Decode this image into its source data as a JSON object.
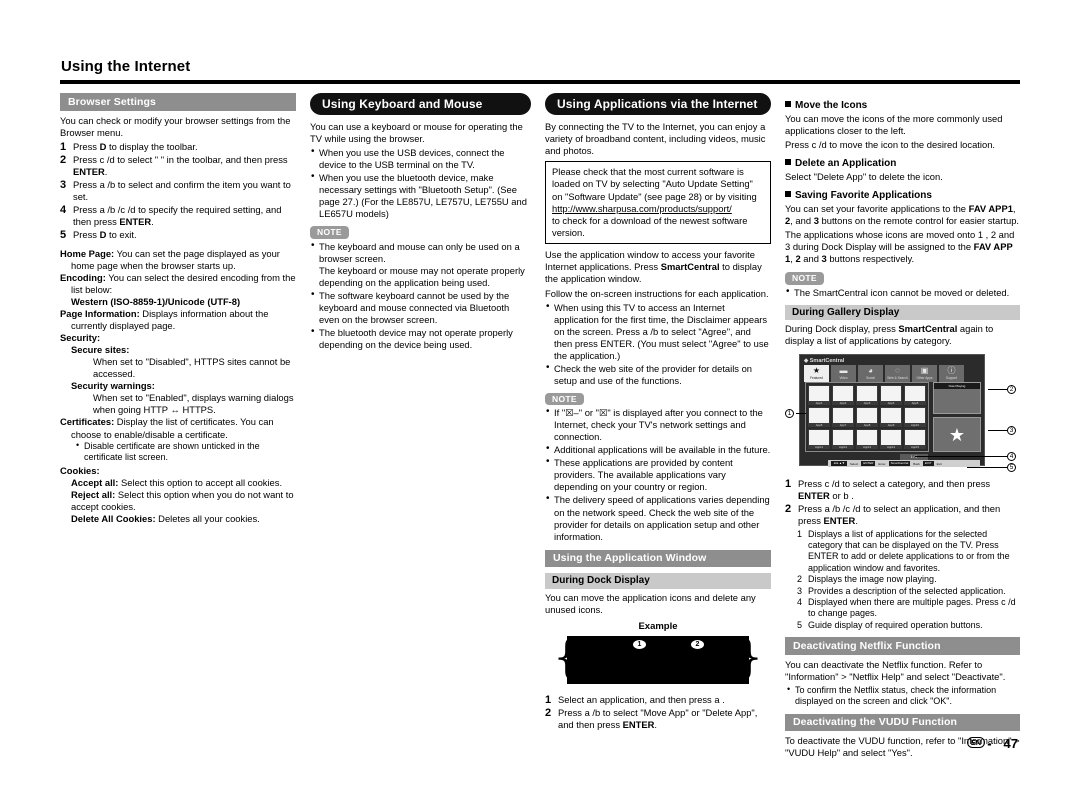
{
  "page": {
    "title": "Using the Internet",
    "footer_locale": "EN",
    "footer_sep": "-",
    "footer_page": "47"
  },
  "col1": {
    "heading": "Browser Settings",
    "intro": "You can check or modify your browser settings from the Browser menu.",
    "steps": [
      {
        "n": "1",
        "text_a": "Press ",
        "bold_a": "D",
        "text_b": " to display the toolbar."
      },
      {
        "n": "2",
        "text_a": "Press c /d  to select \"     \" in the toolbar, and then press ",
        "bold_a": "ENTER",
        "text_b": "."
      },
      {
        "n": "3",
        "text_a": "Press a /b  to select and confirm the item you want to set.",
        "bold_a": "",
        "text_b": ""
      },
      {
        "n": "4",
        "text_a": "Press a /b /c /d  to specify the required setting, and then press ",
        "bold_a": "ENTER",
        "text_b": "."
      },
      {
        "n": "5",
        "text_a": "Press ",
        "bold_a": "D",
        "text_b": " to exit."
      }
    ],
    "terms": [
      {
        "term": "Home Page:",
        "desc": " You can set the page displayed as your home page when the browser starts up."
      },
      {
        "term": "Encoding:",
        "desc": " You can select the desired encoding from the list below:"
      }
    ],
    "encoding_value": "Western (ISO-8859-1)/Unicode (UTF-8)",
    "page_information": {
      "term": "Page Information:",
      "desc": " Displays information about the currently displayed page."
    },
    "security_label": "Security:",
    "secure_sites": {
      "term": "Secure sites:",
      "desc": "When set to \"Disabled\", HTTPS sites cannot be accessed."
    },
    "security_warnings": {
      "term": "Security warnings:",
      "desc": "When set to \"Enabled\", displays warning dialogs when going HTTP ↔ HTTPS."
    },
    "certificates": {
      "term": "Certificates:",
      "desc": " Display the list of certificates. You can choose to enable/disable a certificate."
    },
    "certificates_note": "Disable certificate are shown unticked in the certificate list screen.",
    "cookies_label": "Cookies:",
    "cookies": [
      {
        "term": "Accept all:",
        "desc": " Select this option to accept all cookies."
      },
      {
        "term": "Reject all:",
        "desc": " Select this option when you do not want to accept cookies."
      },
      {
        "term": "Delete All Cookies:",
        "desc": " Deletes all your cookies."
      }
    ]
  },
  "col2": {
    "heading": "Using Keyboard and Mouse",
    "intro": "You can use a keyboard or mouse for operating the TV while using the browser.",
    "bullets": [
      "When you use the USB devices, connect the device to the USB terminal on the TV.",
      "When you use the bluetooth device, make necessary settings with \"Bluetooth Setup\". (See page 27.) (For the LE857U, LE757U, LE755U and LE657U models)"
    ],
    "note_label": "NOTE",
    "notes": [
      "The keyboard and mouse can only be used on a browser screen.\nThe keyboard or mouse may not operate properly depending on the application being used.",
      "The software keyboard cannot be used by the keyboard and mouse connected via Bluetooth even on the browser screen.",
      "The bluetooth device may not operate properly depending on the device being used."
    ]
  },
  "col3": {
    "heading": "Using Applications via the Internet",
    "intro": "By connecting the TV to the Internet, you can enjoy a variety of broadband content, including videos, music and photos.",
    "box": {
      "line1": "Please check that the most current software is loaded on TV by selecting \"Auto Update Setting\"",
      "line2": "on \"Software Update\" (see page 28) or by visiting",
      "url": "http://www.sharpusa.com/products/support/",
      "line3": "to check for a download of the newest software version."
    },
    "body_1": "Use the application window to access your favorite Internet applications. Press ",
    "body_bold": "SmartCentral",
    "body_2": " to display the application window.",
    "body_3": "Follow the on-screen instructions for each application.",
    "bullets": [
      "When using this TV to access an Internet application for the first time, the Disclaimer appears on the screen. Press a /b  to select \"Agree\", and then press ENTER. (You must select \"Agree\" to use the application.)",
      "Check the web site of the provider for details on setup and use of the functions."
    ],
    "note_label": "NOTE",
    "notes": [
      "If \"☒–\" or \"☒\" is displayed after you connect to the Internet, check your TV's network settings and connection.",
      "Additional applications will be available in the future.",
      "These applications are provided by content providers. The available applications vary depending on your country or region.",
      "The delivery speed of applications varies depending on the network speed. Check the web site of the provider for details on application setup and other information."
    ],
    "app_window_heading": "Using the Application Window",
    "dock_heading": "During Dock Display",
    "dock_intro": "You can move the application icons and delete any unused icons.",
    "example_label": "Example",
    "example_badges": [
      "1",
      "2"
    ],
    "dock_steps": [
      {
        "n": "1",
        "text": "Select an application, and then press a ."
      },
      {
        "n": "2",
        "text_a": "Press a /b  to select \"Move App\" or \"Delete App\", and then press ",
        "bold": "ENTER",
        "text_b": "."
      }
    ]
  },
  "col4": {
    "move_icons": {
      "heading": "Move the Icons",
      "body": "You can move the icons of the more commonly used applications closer to the left.",
      "body2": "Press c /d  to move the icon to the desired location."
    },
    "delete_app": {
      "heading": "Delete an Application",
      "body": "Select \"Delete App\" to delete the icon."
    },
    "saving_fav": {
      "heading": "Saving Favorite Applications",
      "body_1": "You can set your favorite applications to the ",
      "bold_1": "FAV APP1",
      "body_2": ", ",
      "bold_2": "2",
      "body_3": ", and ",
      "bold_3": "3",
      "body_4": " buttons on the remote control for easier startup.",
      "body_5": "The applications whose icons are moved onto 1 , 2  and 3  during Dock Display will be assigned to the ",
      "bold_5": "FAV APP 1",
      "body_6": ", ",
      "bold_6": "2",
      "body_7": " and ",
      "bold_7": "3",
      "body_8": " buttons respectively."
    },
    "note_label": "NOTE",
    "note": "The SmartCentral icon cannot be moved or deleted.",
    "gallery": {
      "heading": "During Gallery Display",
      "intro_1": "During Dock display, press ",
      "intro_bold": "SmartCentral",
      "intro_2": " again to display a list of applications by category.",
      "screen_title": "SmartCentral",
      "tabs": [
        {
          "icon": "star-icon",
          "glyph": "★",
          "label": "Featured"
        },
        {
          "icon": "tv-icon",
          "glyph": "▬",
          "label": "Video"
        },
        {
          "icon": "social-icon",
          "glyph": "◕",
          "label": "Social"
        },
        {
          "icon": "globe-icon",
          "glyph": "◌",
          "label": "Web & Search"
        },
        {
          "icon": "apps-icon",
          "glyph": "▣",
          "label": "Other Apps"
        },
        {
          "icon": "info-icon",
          "glyph": "ⓘ",
          "label": "Support"
        }
      ],
      "cells": [
        "App1",
        "App2",
        "App3",
        "App4",
        "App5",
        "App6",
        "App7",
        "App8",
        "App9",
        "App10",
        "App11",
        "App12",
        "App13",
        "App14",
        "App15"
      ],
      "right_top_bar": "Now Playing",
      "page_indicator": "1 / 3",
      "guide_keys": [
        {
          "key": "◄►▲▼",
          "label": "Select"
        },
        {
          "key": "ENTER",
          "label": "Enter"
        },
        {
          "key": "SmartCentral",
          "label": "Back"
        },
        {
          "key": "EXIT",
          "label": "Exit"
        }
      ],
      "callouts": [
        "1",
        "2",
        "3",
        "4",
        "5"
      ],
      "steps": [
        {
          "n": "1",
          "text_a": "Press c /d  to select a category, and then press ",
          "bold": "ENTER",
          "text_b": " or b ."
        },
        {
          "n": "2",
          "text_a": "Press a /b /c /d  to select an application, and then press ",
          "bold": "ENTER",
          "text_b": "."
        }
      ],
      "substeps": [
        {
          "n": "1",
          "text": "Displays a list of applications for the selected category that can be displayed on the TV. Press ENTER to add or delete applications to or from the application window and favorites."
        },
        {
          "n": "2",
          "text": "Displays the image now playing."
        },
        {
          "n": "3",
          "text": "Provides a description of the selected application."
        },
        {
          "n": "4",
          "text": "Displayed when there are multiple pages. Press c /d  to change pages."
        },
        {
          "n": "5",
          "text": "Guide display of required operation buttons."
        }
      ]
    },
    "netflix": {
      "heading": "Deactivating Netflix Function",
      "body": "You can deactivate the Netflix function. Refer to \"Information\" > \"Netflix Help\" and select \"Deactivate\".",
      "bullet": "To confirm the Netflix status, check the information displayed on the screen and click \"OK\"."
    },
    "vudu": {
      "heading": "Deactivating the VUDU Function",
      "body": "To deactivate the VUDU function, refer to \"Information\" > \"VUDU Help\" and select \"Yes\"."
    }
  }
}
